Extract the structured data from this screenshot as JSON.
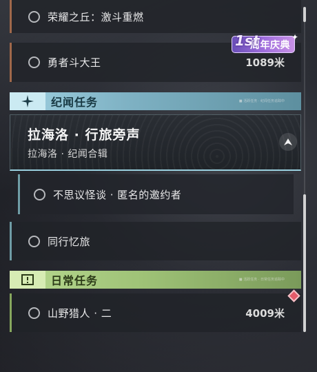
{
  "quests_top": [
    {
      "name": "荣耀之丘：激斗重燃",
      "distance": ""
    },
    {
      "name": "勇者斗大王",
      "distance": "1089米"
    }
  ],
  "event_badge": {
    "number": "1st",
    "label": "周年庆典"
  },
  "story_section": {
    "title": "纪闻任务",
    "tiny_text": "■ 活跃任务 · 纪闻任务追踪中",
    "feature": {
      "title": "拉海洛 · 行旅旁声",
      "subtitle": "拉海洛 · 纪闻合辑"
    },
    "sub_quest": "不思议怪谈 · 匿名的邀约者",
    "quest": "同行忆旅"
  },
  "daily_section": {
    "title": "日常任务",
    "tiny_text": "■ 活跃任务 · 日常任务追踪中",
    "quest": {
      "name": "山野猎人 · 二",
      "distance": "4009米"
    }
  },
  "colors": {
    "story_accent": "#9fd0e0",
    "daily_accent": "#b7d890",
    "main_border": "#a0684a",
    "badge": "#9e6ddc"
  }
}
